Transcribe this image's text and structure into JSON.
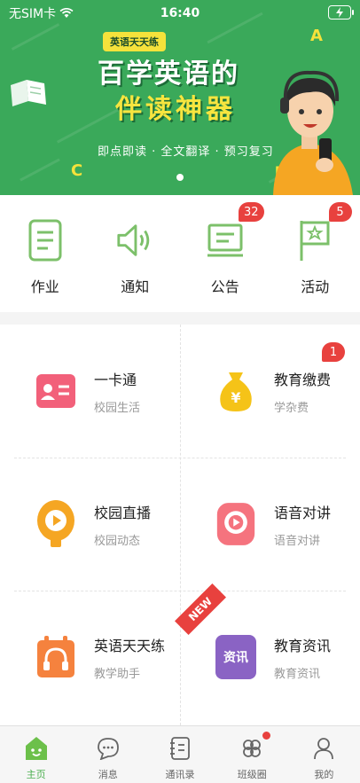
{
  "status_bar": {
    "carrier": "无SIM卡",
    "time": "16:40"
  },
  "banner": {
    "badge": "英语天天练",
    "headline_line1": "百学英语的",
    "headline_line2": "伴读神器",
    "subtitle": "即点即读 · 全文翻译 · 预习复习",
    "letters": [
      "A",
      "C",
      "B",
      "A"
    ],
    "colors": {
      "background": "#3aa95a",
      "accent": "#f5e23b"
    }
  },
  "quick_actions": [
    {
      "label": "作业",
      "icon": "homework-document-icon",
      "badge": ""
    },
    {
      "label": "通知",
      "icon": "speaker-notice-icon",
      "badge": ""
    },
    {
      "label": "公告",
      "icon": "announcement-board-icon",
      "badge": "32"
    },
    {
      "label": "活动",
      "icon": "flag-icon",
      "badge": "5"
    }
  ],
  "services": [
    {
      "title": "一卡通",
      "desc": "校园生活",
      "icon": "id-card-icon",
      "badge": ""
    },
    {
      "title": "教育缴费",
      "desc": "学杂费",
      "icon": "money-bag-icon",
      "badge": "1"
    },
    {
      "title": "校园直播",
      "desc": "校园动态",
      "icon": "live-play-icon",
      "badge": ""
    },
    {
      "title": "语音对讲",
      "desc": "语音对讲",
      "icon": "voice-intercom-icon",
      "badge": ""
    },
    {
      "title": "英语天天练",
      "desc": "教学助手",
      "icon": "headphones-icon",
      "badge": "",
      "ribbon": "NEW"
    },
    {
      "title": "教育资讯",
      "desc": "教育资讯",
      "icon": "news-icon",
      "icon_text": "资讯",
      "badge": ""
    }
  ],
  "tabbar": [
    {
      "label": "主页",
      "icon": "home-icon",
      "active": true
    },
    {
      "label": "消息",
      "icon": "message-icon",
      "active": false
    },
    {
      "label": "通讯录",
      "icon": "contacts-icon",
      "active": false
    },
    {
      "label": "班级圈",
      "icon": "clover-icon",
      "active": false,
      "dot": true
    },
    {
      "label": "我的",
      "icon": "profile-icon",
      "active": false
    }
  ],
  "theme": {
    "green": "#4caf50",
    "badge_red": "#e8413e"
  }
}
